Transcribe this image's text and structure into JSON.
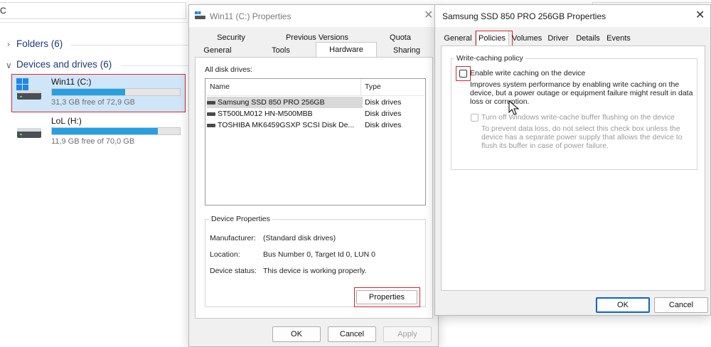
{
  "explorer": {
    "address_tail": "C",
    "sections": [
      {
        "label": "Folders (6)",
        "collapsed": true
      },
      {
        "label": "Devices and drives (6)",
        "collapsed": false
      }
    ],
    "drives": [
      {
        "name": "Win11 (C:)",
        "free": "31,3 GB free of 72,9 GB",
        "used_fraction": 0.57,
        "selected": true
      },
      {
        "name": "LoL (H:)",
        "free": "11,9 GB free of 70,0 GB",
        "used_fraction": 0.83,
        "selected": false
      }
    ]
  },
  "props_dialog": {
    "title": "Win11 (C:) Properties",
    "tabs_back": [
      "Security",
      "Previous Versions",
      "Quota"
    ],
    "tabs_front": [
      "General",
      "Tools",
      "Hardware",
      "Sharing"
    ],
    "active_tab": "Hardware",
    "all_disk_drives_label": "All disk drives:",
    "columns": [
      "Name",
      "Type"
    ],
    "drives": [
      {
        "name": "Samsung SSD 850 PRO 256GB",
        "type": "Disk drives",
        "selected": true
      },
      {
        "name": "ST500LM012 HN-M500MBB",
        "type": "Disk drives",
        "selected": false
      },
      {
        "name": "TOSHIBA MK6459GSXP SCSI Disk De...",
        "type": "Disk drives",
        "selected": false
      }
    ],
    "device_properties": {
      "group_label": "Device Properties",
      "manufacturer_label": "Manufacturer:",
      "manufacturer_value": "(Standard disk drives)",
      "location_label": "Location:",
      "location_value": "Bus Number 0, Target Id 0, LUN 0",
      "status_label": "Device status:",
      "status_value": "This device is working properly."
    },
    "properties_button": "Properties",
    "ok": "OK",
    "cancel": "Cancel",
    "apply": "Apply"
  },
  "ssd_dialog": {
    "title": "Samsung SSD 850 PRO 256GB Properties",
    "tabs": [
      "General",
      "Policies",
      "Volumes",
      "Driver",
      "Details",
      "Events"
    ],
    "active_tab": "Policies",
    "group_label": "Write-caching policy",
    "enable_caching_label": "Enable write caching on the device",
    "enable_caching_checked": false,
    "enable_caching_desc": "Improves system performance by enabling write caching on the device, but a power outage or equipment failure might result in data loss or corruption.",
    "turn_off_flush_label": "Turn off Windows write-cache buffer flushing on the device",
    "turn_off_flush_desc": "To prevent data loss, do not select this check box unless the device has a separate power supply that allows the device to flush its buffer in case of power failure.",
    "ok": "OK",
    "cancel": "Cancel"
  },
  "colors": {
    "accent_fill": "#27a0e1",
    "selection_blue": "#cfe6f9",
    "highlight_red": "#d9262c"
  }
}
